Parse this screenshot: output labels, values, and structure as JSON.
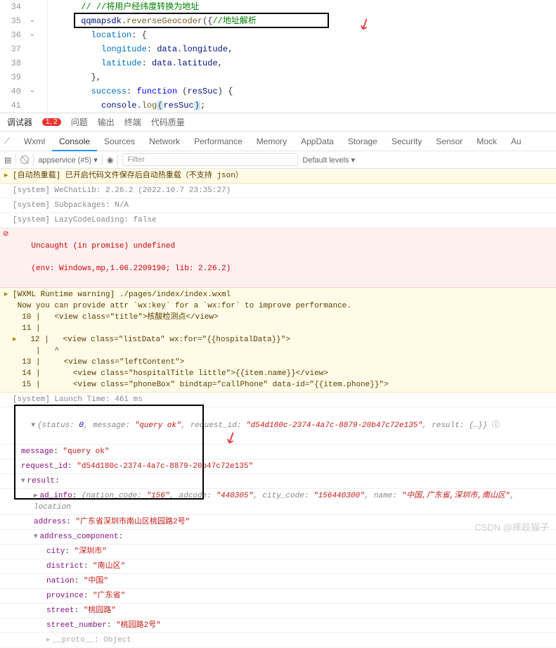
{
  "editor": {
    "lines": {
      "l34": "// //将用户经纬度转换为地址",
      "l35a": "qqmapsdk",
      "l35b": "reverseGeocoder",
      "l35c": "//地址解析",
      "l36": "location",
      "l37a": "longitude",
      "l37b": "data",
      "l37c": "longitude",
      "l38a": "latitude",
      "l38b": "data",
      "l38c": "latitude",
      "l40a": "success",
      "l40b": "function",
      "l40c": "resSuc",
      "l41a": "console",
      "l41b": "log",
      "l41c": "resSuc"
    },
    "gutters": [
      "34",
      "35",
      "36",
      "37",
      "38",
      "39",
      "40",
      "41"
    ]
  },
  "panel": {
    "title": "调试器",
    "badge": "1, 2",
    "tabs": [
      "问题",
      "输出",
      "终端",
      "代码质量"
    ]
  },
  "devtabs": [
    "Wxml",
    "Console",
    "Sources",
    "Network",
    "Performance",
    "Memory",
    "AppData",
    "Storage",
    "Security",
    "Sensor",
    "Mock",
    "Au"
  ],
  "devtabs_active": 1,
  "toolbar": {
    "context": "appservice (#5)",
    "filter_placeholder": "Filter",
    "levels": "Default levels"
  },
  "console": {
    "m0": "[自动热重载] 已开启代码文件保存后自动热重载（不支持 json）",
    "m1": "[system] WeChatLib: 2.26.2 (2022.10.7 23:35:27)",
    "m2": "[system] Subpackages: N/A",
    "m3": "[system] LazyCodeLoading: false",
    "err1": "Uncaught (in promise) undefined",
    "err2": "(env: Windows,mp,1.06.2209190; lib: 2.26.2)",
    "w1": "[WXML Runtime warning] ./pages/index/index.wxml",
    "w2": " Now you can provide attr `wx:key` for a `wx:for` to improve performance.",
    "w3": "  10 |   <view class=\"title\">核酸检测点</view>",
    "w4": "  11 | ",
    "w5": "  12 |   <view class=\"listData\" wx:for=\"{{hospitalData}}\">",
    "w6": "     |   ^",
    "w7": "  13 |     <view class=\"leftContent\">",
    "w8": "  14 |       <view class=\"hospitalTitle little\">{{item.name}}</view>",
    "w9": "  15 |       <view class=\"phoneBox\" bindtap=\"callPhone\" data-id=\"{{item.phone}}\">",
    "m4": "[system] Launch Time: 461 ms",
    "obj": {
      "status_label": "status",
      "status": "0",
      "message_label": "message",
      "message": "\"query ok\"",
      "request_id_label": "request_id",
      "request_id": "\"d54d180c-2374-4a7c-8879-20b47c72e135\"",
      "result_label": "result",
      "result_tail": "{…}",
      "ad_info_label": "ad_info",
      "nation_code": "\"156\"",
      "adcode": "\"440305\"",
      "city_code": "\"156440300\"",
      "name": "\"中国,广东省,深圳市,南山区\"",
      "address_label": "address",
      "address": "\"广东省深圳市南山区桃园路2号\"",
      "ac_label": "address_component",
      "city_l": "city",
      "city": "\"深圳市\"",
      "district_l": "district",
      "district": "\"南山区\"",
      "nation_l": "nation",
      "nation": "\"中国\"",
      "province_l": "province",
      "province": "\"广东省\"",
      "street_l": "street",
      "street": "\"桃园路\"",
      "street_number_l": "street_number",
      "street_number": "\"桃园路2号\"",
      "proto": "Object"
    }
  },
  "watermark": "CSDN @摔跤猫子"
}
